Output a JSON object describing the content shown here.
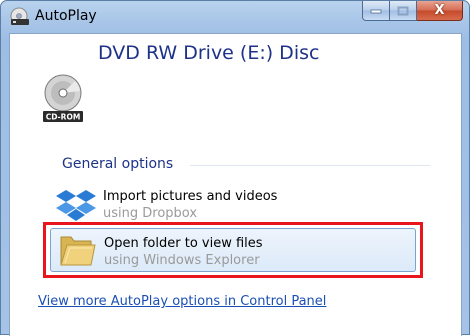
{
  "window": {
    "title": "AutoPlay",
    "close_glyph": "X"
  },
  "device": {
    "title": "DVD RW Drive (E:) Disc",
    "icon": "cd-rom-icon",
    "icon_label": "CD-ROM"
  },
  "general_options": {
    "heading": "General options",
    "options": [
      {
        "label": "Import pictures and videos",
        "sub": "using Dropbox",
        "icon": "dropbox-icon"
      },
      {
        "label": "Open folder to view files",
        "sub": "using Windows Explorer",
        "icon": "folder-icon"
      }
    ]
  },
  "footer": {
    "link": "View more AutoPlay options in Control Panel"
  },
  "colors": {
    "heading_blue": "#1e3287",
    "link_blue": "#1a4fb5",
    "highlight_red": "#e8161c",
    "close_red": "#c44a2a"
  }
}
